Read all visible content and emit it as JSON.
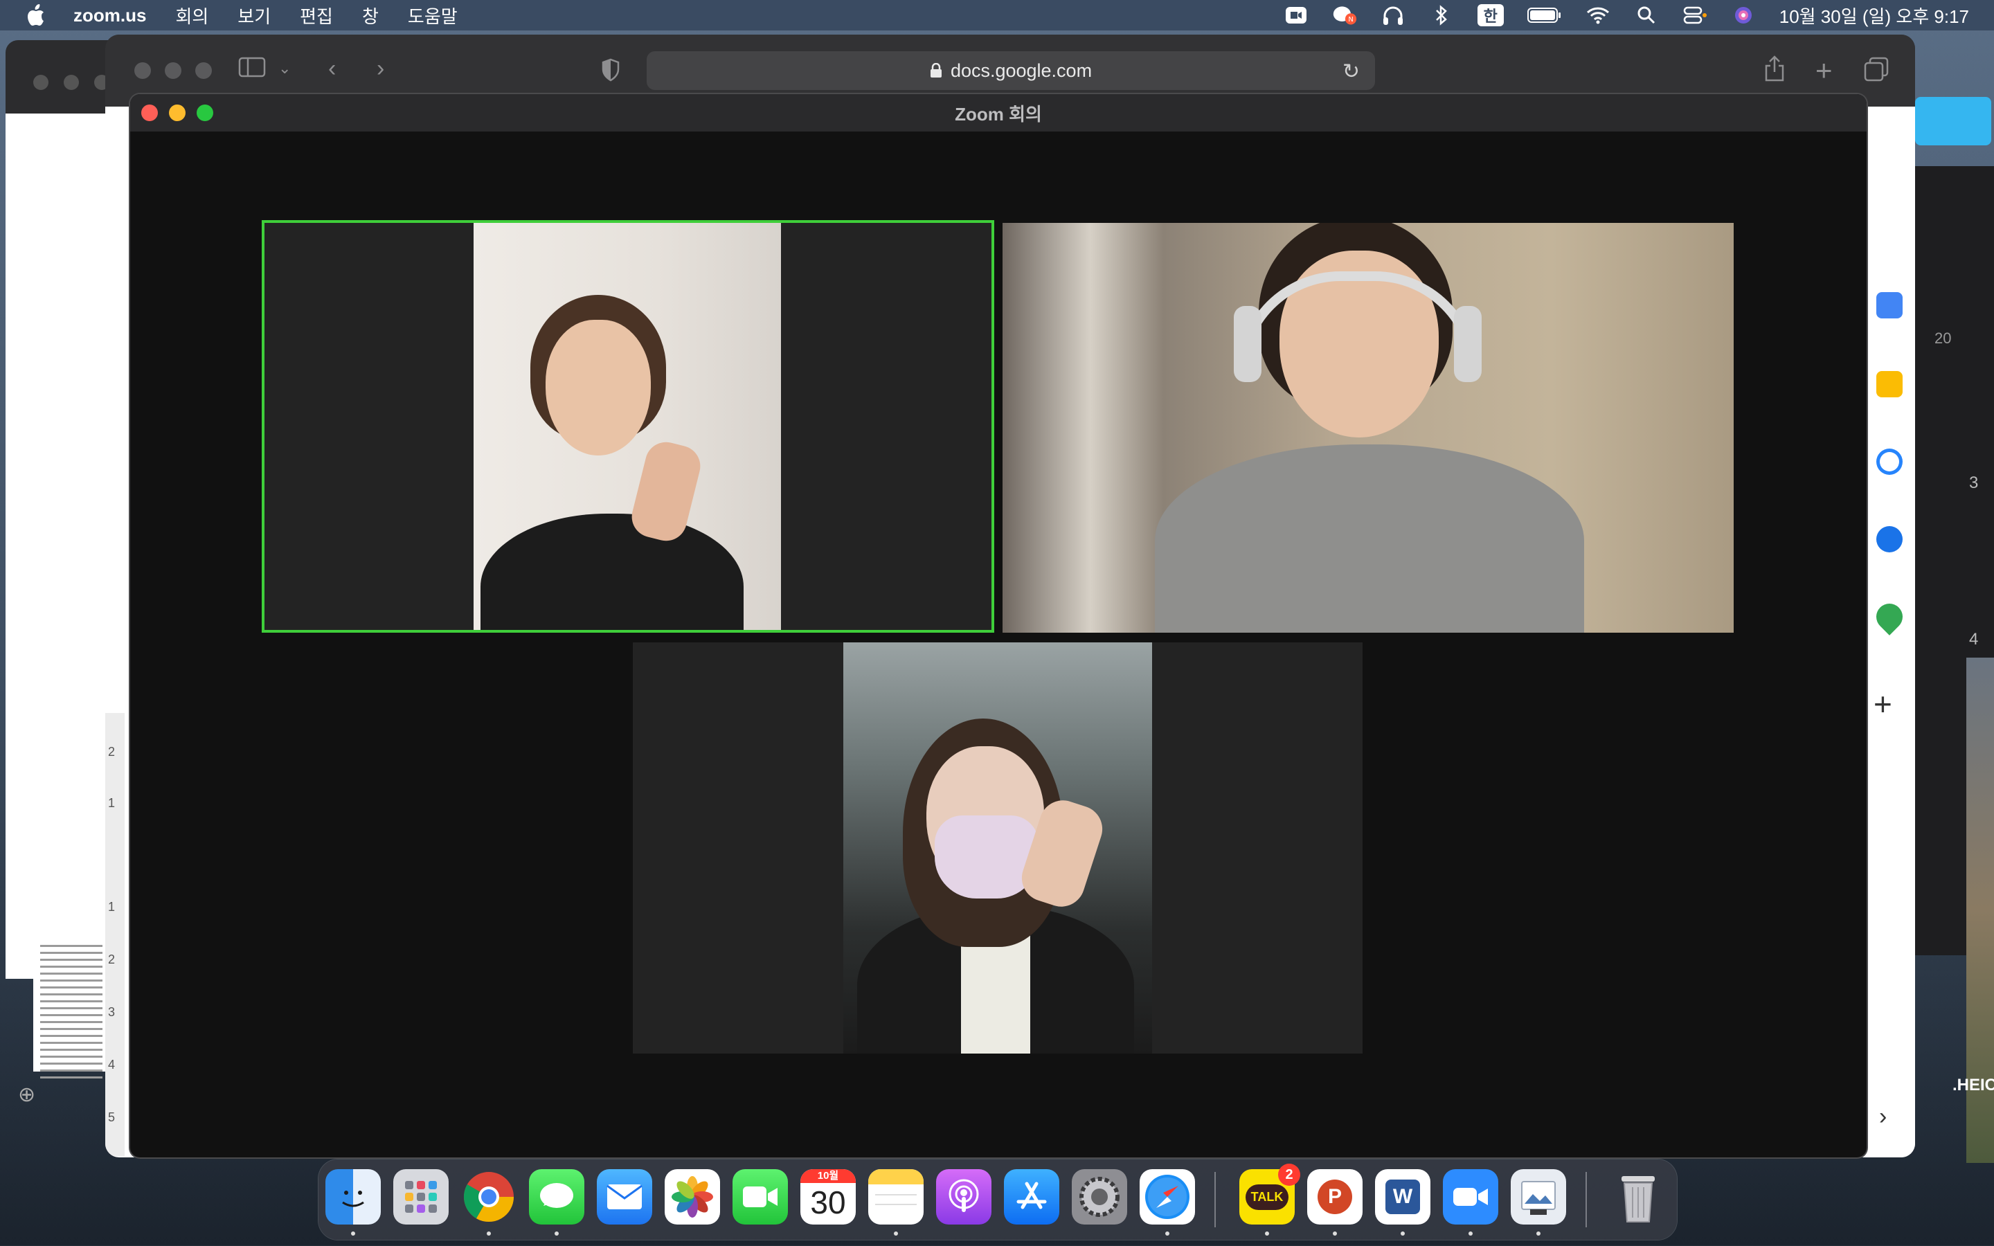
{
  "menubar": {
    "app_name": "zoom.us",
    "menus": [
      "회의",
      "보기",
      "편집",
      "창",
      "도움말"
    ],
    "input_source": "한",
    "clock": "10월 30일 (일) 오후 9:17"
  },
  "safari": {
    "url": "docs.google.com"
  },
  "zoom": {
    "title": "Zoom 회의"
  },
  "dock": {
    "calendar_month": "10월",
    "calendar_day": "30",
    "kakaotalk_label": "TALK",
    "kakaotalk_badge": "2",
    "powerpoint_letter": "P",
    "word_letter": "W"
  },
  "background": {
    "file_label": ".HEIC",
    "ruler_numbers": [
      "2",
      "1",
      "1",
      "2",
      "3",
      "4",
      "5"
    ],
    "side_number_a": "3",
    "side_number_b": "4",
    "side_number_c": "20"
  },
  "colors": {
    "active_speaker_border": "#3fce3a",
    "menubar_bg": "#3a4b62",
    "zoom_bg": "#111111"
  }
}
